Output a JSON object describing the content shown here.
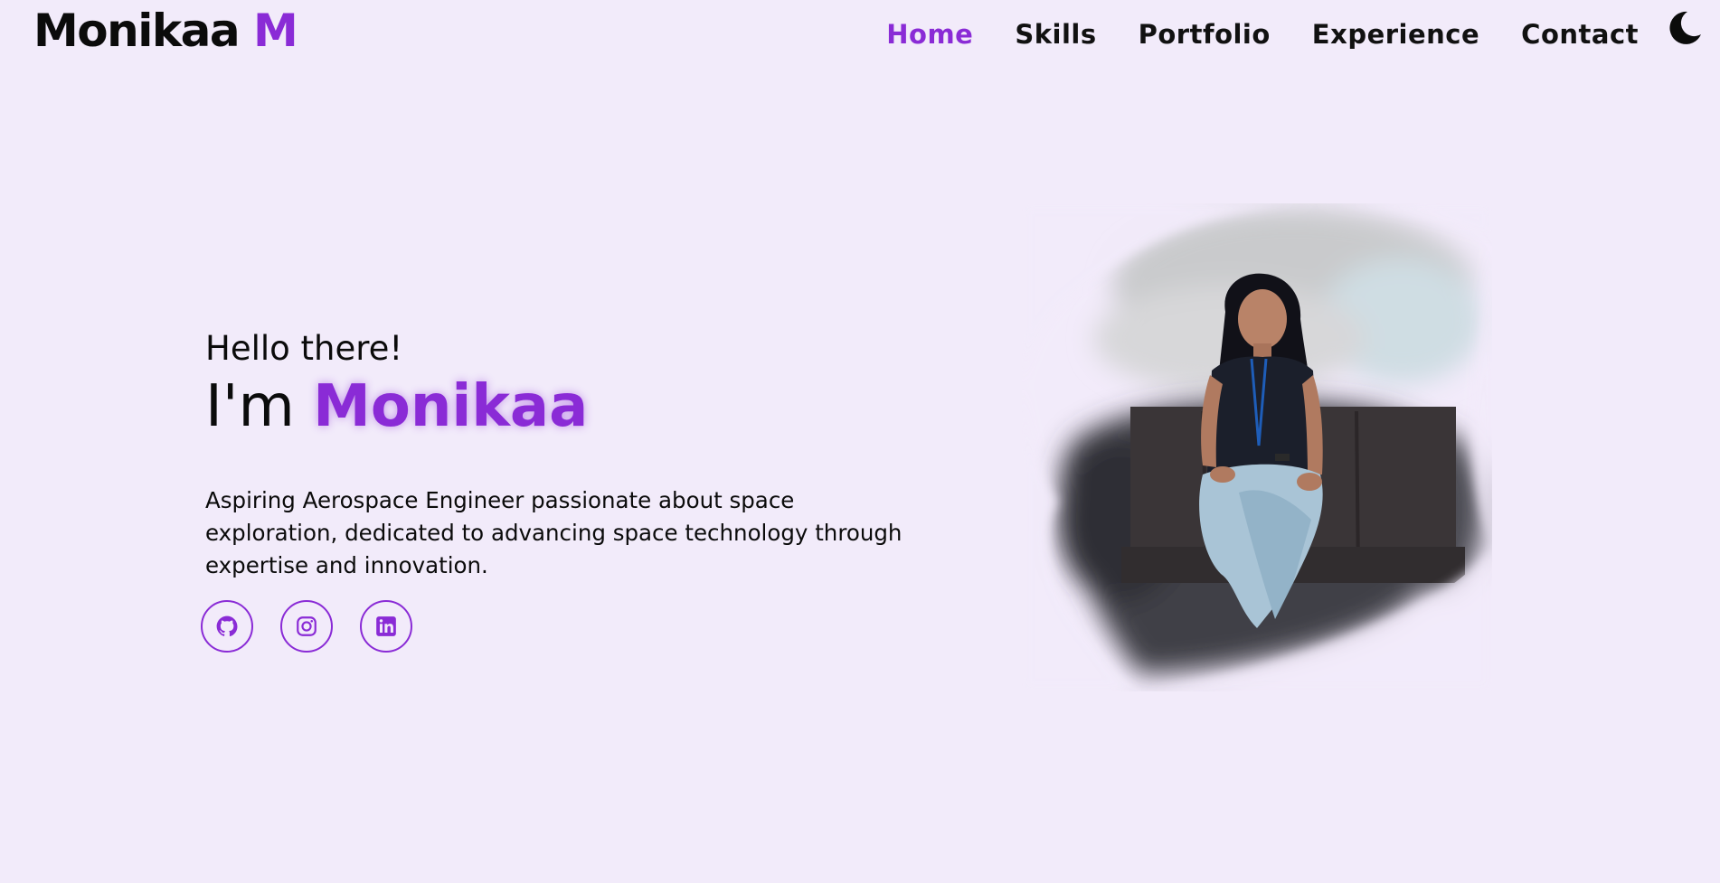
{
  "header": {
    "logo_name": "Monikaa",
    "logo_initial": "M",
    "nav": [
      {
        "label": "Home",
        "active": true
      },
      {
        "label": "Skills",
        "active": false
      },
      {
        "label": "Portfolio",
        "active": false
      },
      {
        "label": "Experience",
        "active": false
      },
      {
        "label": "Contact",
        "active": false
      }
    ],
    "theme_toggle_icon": "moon-icon"
  },
  "hero": {
    "greeting": "Hello there!",
    "intro_prefix": "I'm",
    "name": "Monikaa",
    "tagline": "Aspiring Aerospace Engineer passionate about space exploration, dedicated to advancing space technology through expertise and innovation."
  },
  "socials": [
    {
      "icon": "github-icon"
    },
    {
      "icon": "instagram-icon"
    },
    {
      "icon": "linkedin-icon"
    }
  ],
  "colors": {
    "accent": "#8a2bd6",
    "background": "#f2ebfa",
    "text": "#0b0b0b"
  }
}
